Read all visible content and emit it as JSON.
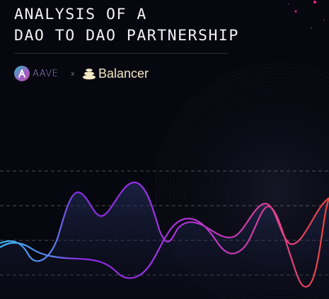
{
  "title": {
    "line1": "ANALYSIS OF A",
    "line2": "DAO TO DAO PARTNERSHIP"
  },
  "logos": {
    "left": {
      "icon": "aave-logo-icon",
      "word": "AAVE"
    },
    "separator": "x",
    "right": {
      "icon": "balancer-logo-icon",
      "word": "Balancer"
    }
  },
  "colors": {
    "background": "#07070f",
    "title": "#f2f2f4",
    "aave_gradient": [
      "#2ebac6",
      "#b6509e"
    ],
    "balancer": "#f4e7c4",
    "wave_gradient": [
      "#40b4f0",
      "#8a2be2",
      "#d946a0",
      "#f04436"
    ],
    "dot_accent": "#e0207f"
  }
}
